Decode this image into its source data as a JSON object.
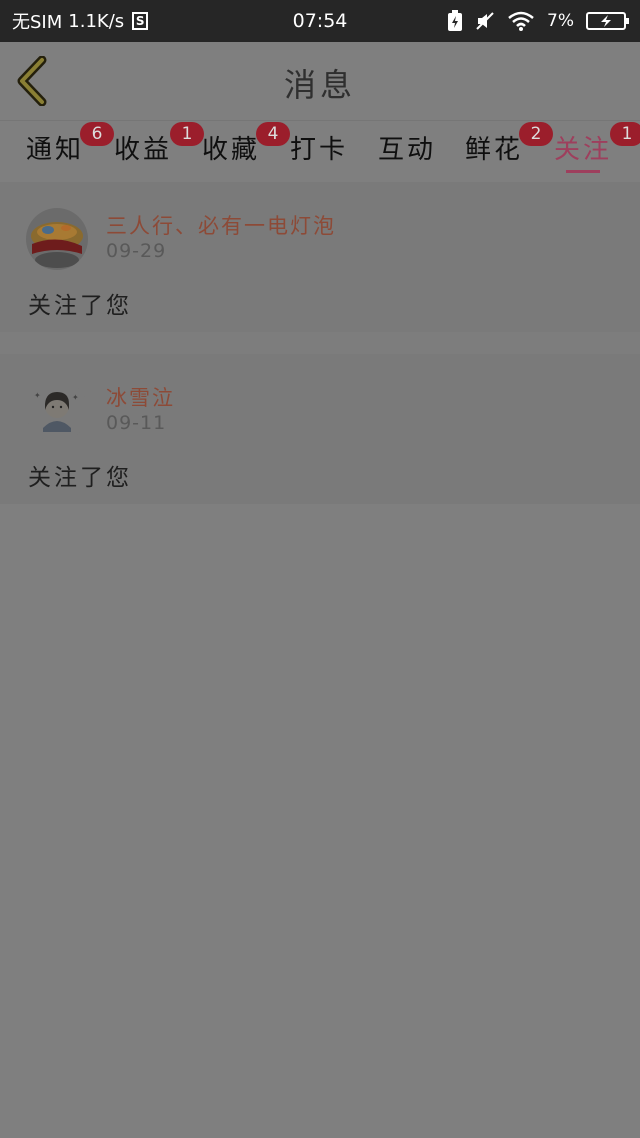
{
  "status_bar": {
    "carrier": "无SIM",
    "speed": "1.1K/s",
    "s_icon_label": "S",
    "time": "07:54",
    "battery_percent": "7%",
    "icons": [
      "charging-icon",
      "mute-icon",
      "wifi-icon",
      "battery-icon"
    ]
  },
  "header": {
    "title": "消息",
    "back_icon": "chevron-left-icon"
  },
  "tabs": [
    {
      "label": "通知",
      "badge": "6",
      "active": false
    },
    {
      "label": "收益",
      "badge": "1",
      "active": false
    },
    {
      "label": "收藏",
      "badge": "4",
      "active": false
    },
    {
      "label": "打卡",
      "badge": "",
      "active": false
    },
    {
      "label": "互动",
      "badge": "",
      "active": false
    },
    {
      "label": "鲜花",
      "badge": "2",
      "active": false
    },
    {
      "label": "关注",
      "badge": "1",
      "active": true
    }
  ],
  "messages": [
    {
      "username": "三人行、必有一电灯泡",
      "date": "09-29",
      "text": "关注了您"
    },
    {
      "username": "冰雪泣",
      "date": "09-11",
      "text": "关注了您"
    }
  ],
  "colors": {
    "overlay": "#7f7f7f",
    "accent": "#9e3f5d",
    "badge": "#9b1e2b",
    "username": "#8d4a37"
  }
}
